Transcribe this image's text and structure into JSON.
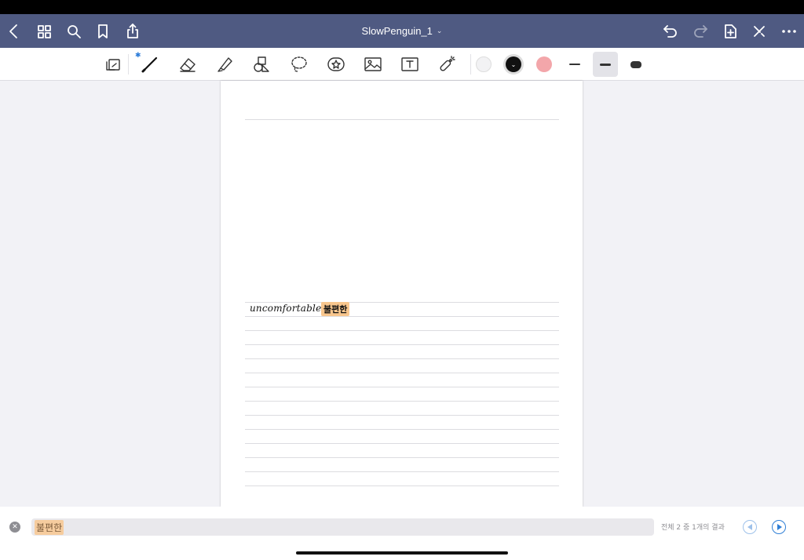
{
  "document": {
    "title": "SlowPenguin_1",
    "title_chevron": "⌄"
  },
  "title_bar": {
    "icons": [
      "back-icon",
      "thumbnails-icon",
      "search-icon",
      "bookmark-icon",
      "share-icon",
      "undo-icon",
      "redo-icon",
      "add-page-icon",
      "close-edit-icon",
      "more-icon"
    ]
  },
  "toolbar": {
    "bluetooth_mark": "✱",
    "tools": [
      "zoom-window-icon",
      "pen-icon",
      "eraser-icon",
      "highlighter-icon",
      "shapes-icon",
      "lasso-icon",
      "sticker-icon",
      "image-icon",
      "text-icon",
      "laser-pointer-icon"
    ],
    "selected_tool": "pen",
    "colors": [
      {
        "name": "white",
        "hex": "#f2f2f4",
        "selected": false
      },
      {
        "name": "black",
        "hex": "#111111",
        "selected": true
      },
      {
        "name": "pink",
        "hex": "#f3a6aa",
        "selected": false
      }
    ],
    "stroke_widths": [
      "fine",
      "medium",
      "thick"
    ],
    "selected_width": "medium"
  },
  "page": {
    "handwriting_word": "uncomfortable",
    "handwriting_highlight": "불편한",
    "highlight_color": "#f8c68d"
  },
  "search": {
    "query": "불편한",
    "result_text": "전체 2 중 1개의 결과",
    "accent": "#2f7fd6"
  }
}
